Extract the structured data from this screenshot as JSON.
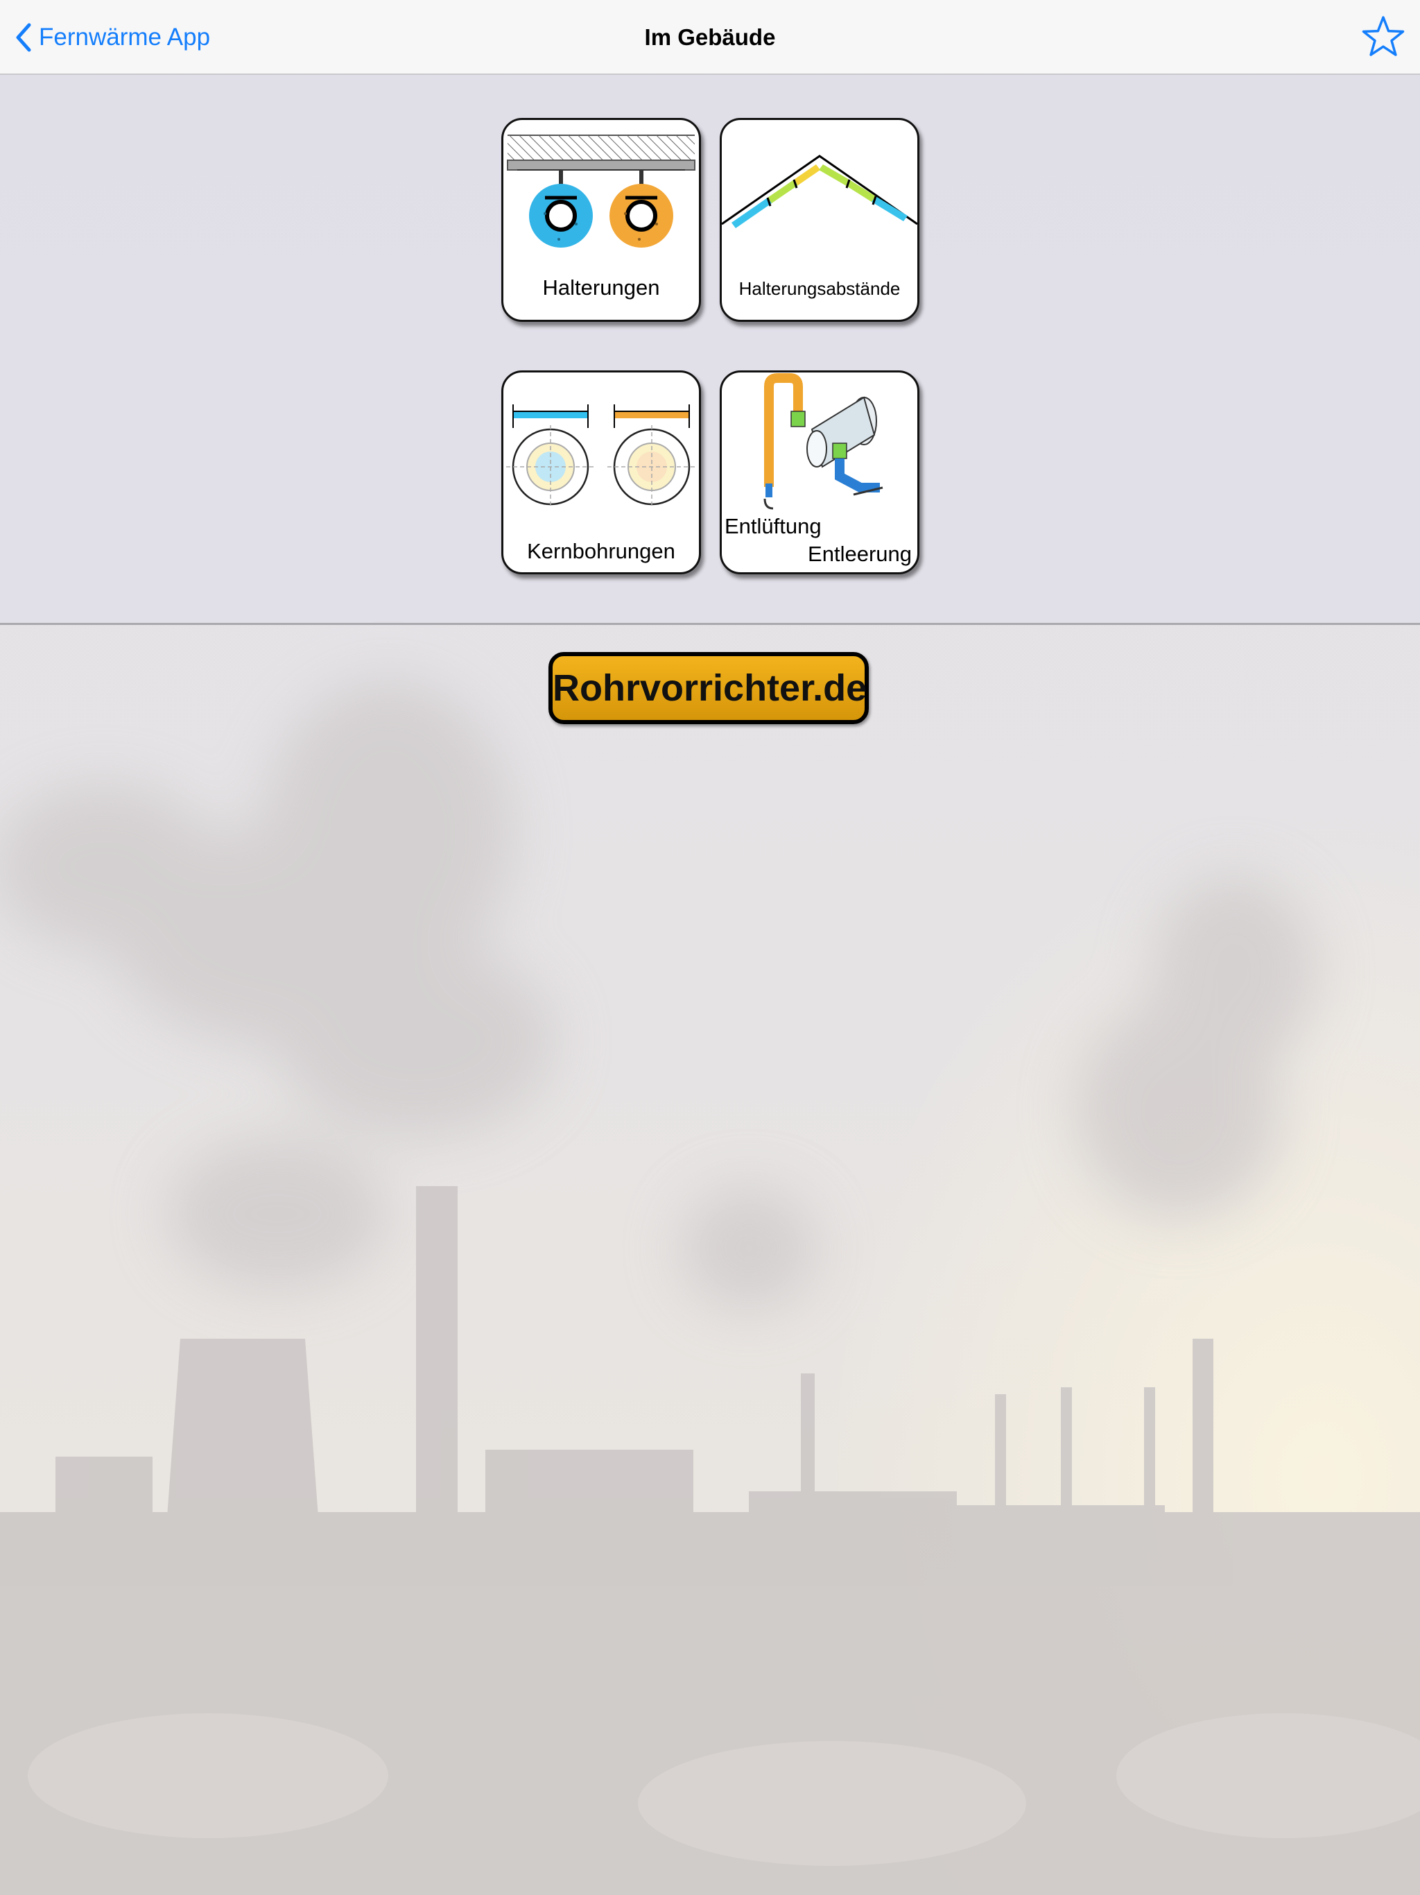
{
  "nav": {
    "back_label": "Fernwärme App",
    "title": "Im Gebäude",
    "favorite_icon": "star-outline-icon",
    "accent_color": "#147efb"
  },
  "tiles": [
    {
      "label": "Halterungen",
      "icon": "pipe-hangers-icon"
    },
    {
      "label": "Halterungsabstände",
      "icon": "support-spacing-icon"
    },
    {
      "label": "Kernbohrungen",
      "icon": "core-drilling-icon"
    },
    {
      "label_line1": "Entlüftung",
      "label_line2": "Entleerung",
      "icon": "venting-draining-icon"
    }
  ],
  "footer_button": {
    "label": "Rohrvorrichter.de",
    "color": "#e6a40f"
  }
}
